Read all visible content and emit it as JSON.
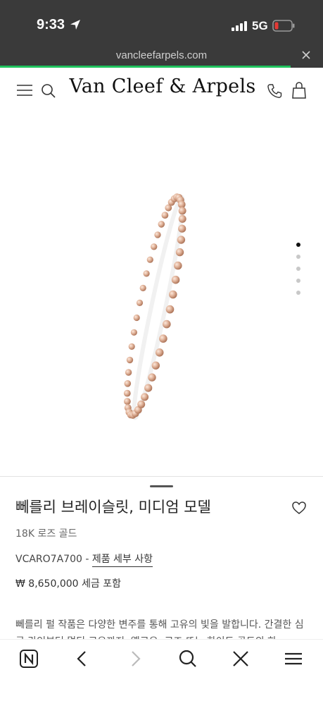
{
  "status_bar": {
    "time": "9:33",
    "network": "5G",
    "location_icon": "location-arrow-icon",
    "signal_icon": "signal-icon",
    "battery_icon": "battery-low-icon"
  },
  "browser": {
    "url": "vancleefarpels.com",
    "load_progress": 0.9,
    "close_icon": "close-icon"
  },
  "header": {
    "brand": "Van Cleef & Arpels",
    "icons": [
      "menu-icon",
      "search-icon",
      "phone-icon",
      "shopping-bag-icon"
    ]
  },
  "gallery": {
    "image": "rose gold beaded bracelet",
    "total_slides": 5,
    "active_slide": 1
  },
  "product": {
    "title": "뻬를리 브레이슬릿, 미디엄 모델",
    "material": "18K 로즈 골드",
    "reference": "VCARO7A700",
    "separator": " - ",
    "details_link": "제품 세부 사항",
    "price": "₩ 8,650,000 세금 포함",
    "description": "뻬를리 펄 작품은 다양한 변주를 통해 고유의 빛을 발합니다. 간결한 심글 라인부터 멀티 로우까지, 옐로우, 로즈 또는 화이트 골드의 하..."
  },
  "colors": {
    "status_bg": "#3a3a3a",
    "load_bar": "#1fc25c",
    "battery_alert": "#e53935",
    "rose_gold": "#d4a085"
  },
  "toolbar": {
    "icons": [
      "naver-n-icon",
      "back-icon",
      "forward-icon",
      "search-icon",
      "close-icon",
      "menu-icon"
    ]
  }
}
